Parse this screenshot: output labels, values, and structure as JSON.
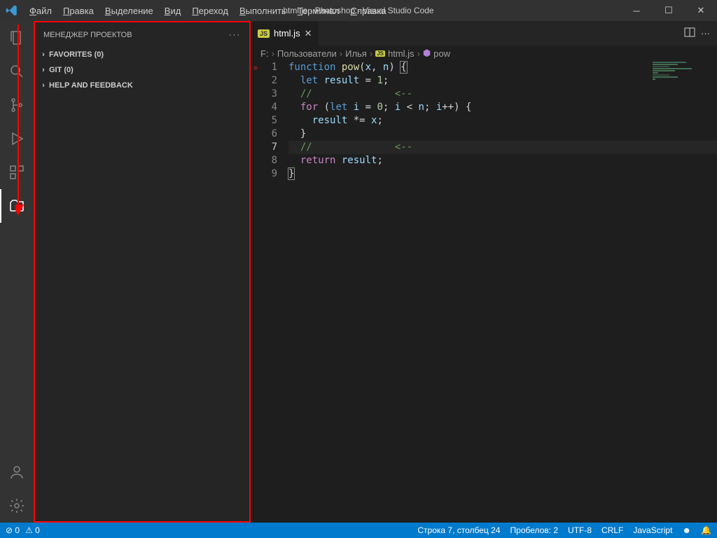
{
  "title": "html.js - Photoshop - Visual Studio Code",
  "menu": [
    "Файл",
    "Правка",
    "Выделение",
    "Вид",
    "Переход",
    "Выполнить",
    "Терминал",
    "Справка"
  ],
  "sidebar": {
    "title": "МЕНЕДЖЕР ПРОЕКТОВ",
    "sections": [
      "FAVORITES (0)",
      "GIT (0)",
      "HELP AND FEEDBACK"
    ]
  },
  "tab": {
    "filename": "html.js",
    "lang": "JS"
  },
  "breadcrumbs": {
    "drive": "F:",
    "parts": [
      "Пользователи",
      "Илья",
      "html.js",
      "pow"
    ]
  },
  "code": {
    "active_line": 7,
    "lines": [
      {
        "n": 1,
        "seg": [
          [
            "kw",
            "function"
          ],
          [
            "op",
            " "
          ],
          [
            "fn",
            "pow"
          ],
          [
            "op",
            "("
          ],
          [
            "var",
            "x"
          ],
          [
            "op",
            ", "
          ],
          [
            "var",
            "n"
          ],
          [
            "op",
            ") "
          ],
          [
            "brace",
            "{"
          ]
        ]
      },
      {
        "n": 2,
        "seg": [
          [
            "op",
            "  "
          ],
          [
            "kw",
            "let"
          ],
          [
            "op",
            " "
          ],
          [
            "var",
            "result"
          ],
          [
            "op",
            " = "
          ],
          [
            "num",
            "1"
          ],
          [
            "op",
            ";"
          ]
        ]
      },
      {
        "n": 3,
        "seg": [
          [
            "op",
            "  "
          ],
          [
            "cmt",
            "//              <--"
          ]
        ]
      },
      {
        "n": 4,
        "seg": [
          [
            "op",
            "  "
          ],
          [
            "kw2",
            "for"
          ],
          [
            "op",
            " ("
          ],
          [
            "kw",
            "let"
          ],
          [
            "op",
            " "
          ],
          [
            "var",
            "i"
          ],
          [
            "op",
            " = "
          ],
          [
            "num",
            "0"
          ],
          [
            "op",
            "; "
          ],
          [
            "var",
            "i"
          ],
          [
            "op",
            " < "
          ],
          [
            "var",
            "n"
          ],
          [
            "op",
            "; "
          ],
          [
            "var",
            "i"
          ],
          [
            "op",
            "++) {"
          ]
        ]
      },
      {
        "n": 5,
        "seg": [
          [
            "op",
            "    "
          ],
          [
            "var",
            "result"
          ],
          [
            "op",
            " *= "
          ],
          [
            "var",
            "x"
          ],
          [
            "op",
            ";"
          ]
        ]
      },
      {
        "n": 6,
        "seg": [
          [
            "op",
            "  }"
          ]
        ]
      },
      {
        "n": 7,
        "seg": [
          [
            "op",
            "  "
          ],
          [
            "cmt",
            "//              <--"
          ]
        ]
      },
      {
        "n": 8,
        "seg": [
          [
            "op",
            "  "
          ],
          [
            "kw2",
            "return"
          ],
          [
            "op",
            " "
          ],
          [
            "var",
            "result"
          ],
          [
            "op",
            ";"
          ]
        ]
      },
      {
        "n": 9,
        "seg": [
          [
            "brace",
            "}"
          ]
        ]
      }
    ]
  },
  "statusbar": {
    "left": [
      "⊘ 0",
      "⚠ 0"
    ],
    "right": [
      "Строка 7, столбец 24",
      "Пробелов: 2",
      "UTF-8",
      "CRLF",
      "JavaScript"
    ]
  }
}
